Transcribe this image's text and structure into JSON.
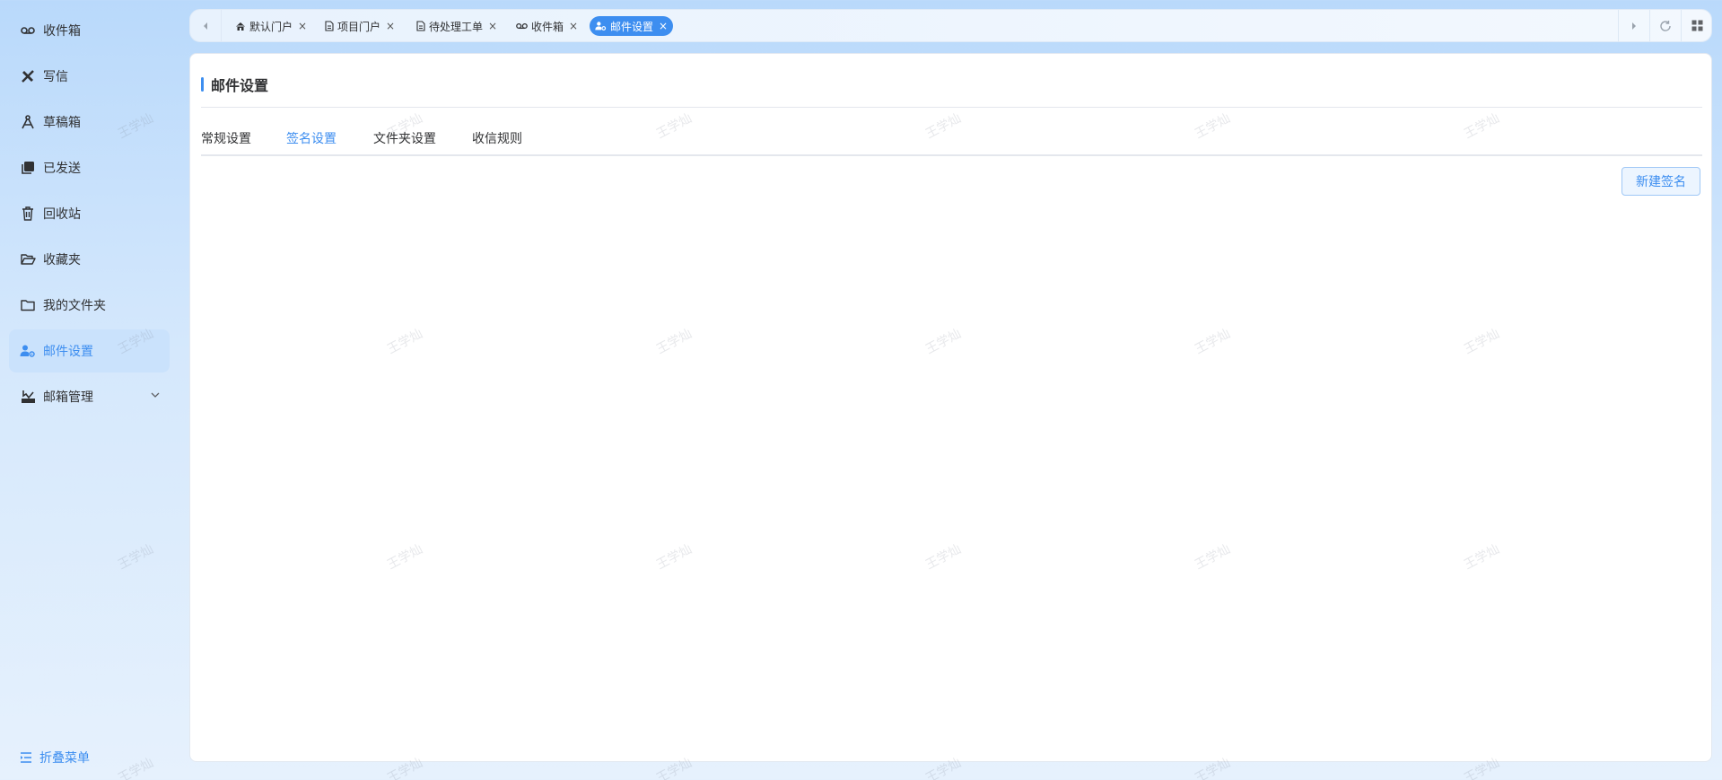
{
  "sidebar": {
    "items": [
      {
        "label": "收件箱",
        "icon": "voicemail-icon"
      },
      {
        "label": "写信",
        "icon": "pen-ruler-icon"
      },
      {
        "label": "草稿箱",
        "icon": "compass-draft-icon"
      },
      {
        "label": "已发送",
        "icon": "sent-stack-icon"
      },
      {
        "label": "回收站",
        "icon": "trash-icon"
      },
      {
        "label": "收藏夹",
        "icon": "folder-open-icon"
      },
      {
        "label": "我的文件夹",
        "icon": "folder-icon"
      },
      {
        "label": "邮件设置",
        "icon": "user-gear-icon",
        "active": true
      },
      {
        "label": "邮箱管理",
        "icon": "inbox-tray-icon",
        "expandable": true
      }
    ],
    "collapse_label": "折叠菜单"
  },
  "tabbar": {
    "tabs": [
      {
        "label": "默认门户",
        "icon": "home-icon"
      },
      {
        "label": "项目门户",
        "icon": "document-icon"
      },
      {
        "label": "待处理工单",
        "icon": "document-icon"
      },
      {
        "label": "收件箱",
        "icon": "voicemail-icon"
      },
      {
        "label": "邮件设置",
        "icon": "user-gear-icon",
        "active": true
      }
    ],
    "close_glyph": "×"
  },
  "main": {
    "title": "邮件设置",
    "tabs": [
      {
        "label": "常规设置"
      },
      {
        "label": "签名设置",
        "active": true
      },
      {
        "label": "文件夹设置"
      },
      {
        "label": "收信规则"
      }
    ],
    "new_button_label": "新建签名"
  },
  "watermark": "王学灿",
  "colors": {
    "accent": "#3d8ef0"
  }
}
